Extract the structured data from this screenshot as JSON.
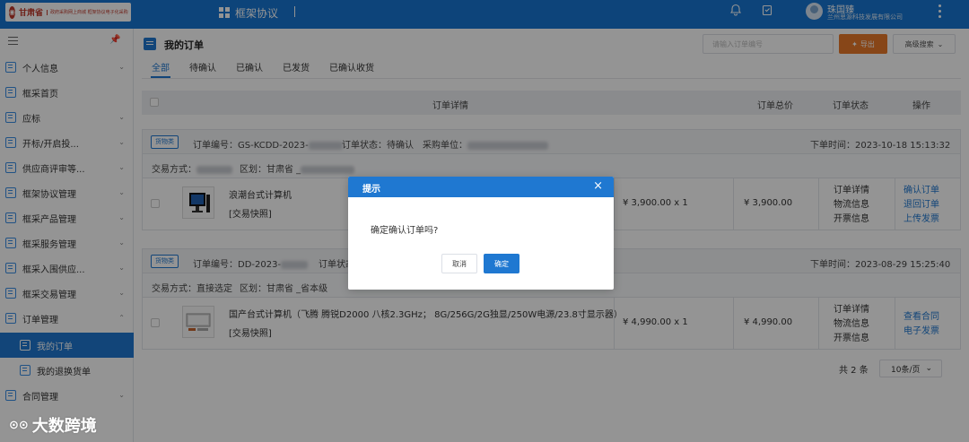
{
  "header": {
    "logo_name": "甘肃省",
    "logo_sub": "政府采购网上商城 框架协议电子化采购",
    "app_title": "框架协议",
    "user_name": "珠国臻",
    "user_org": "兰州思源科技发展有限公司",
    "icons": [
      "bell-icon",
      "clipboard-icon",
      "kebab-icon"
    ]
  },
  "sidebar": {
    "items": [
      {
        "label": "个人信息",
        "chevron": true
      },
      {
        "label": "框采首页",
        "chevron": false
      },
      {
        "label": "应标",
        "chevron": true
      },
      {
        "label": "开标/开启投...",
        "chevron": true
      },
      {
        "label": "供应商评审等...",
        "chevron": true
      },
      {
        "label": "框架协议管理",
        "chevron": true
      },
      {
        "label": "框采产品管理",
        "chevron": true
      },
      {
        "label": "框采服务管理",
        "chevron": true
      },
      {
        "label": "框采入围供应...",
        "chevron": true
      },
      {
        "label": "框采交易管理",
        "chevron": true
      },
      {
        "label": "订单管理",
        "chevron": true,
        "expanded": true
      },
      {
        "label": "我的订单",
        "sub": true,
        "active": true
      },
      {
        "label": "我的退换货单",
        "sub": true
      },
      {
        "label": "合同管理",
        "chevron": true
      }
    ]
  },
  "main": {
    "title": "我的订单",
    "search_placeholder": "请输入订单编号",
    "export_label": "导出",
    "adv_search_label": "高级搜索",
    "tabs": [
      "全部",
      "待确认",
      "已确认",
      "已发货",
      "已确认收货"
    ],
    "active_tab": 0,
    "columns": {
      "detail": "订单详情",
      "total": "订单总价",
      "status": "订单状态",
      "actions": "操作"
    },
    "orders": [
      {
        "badge": "货物类",
        "order_no": "订单编号：GS-KCDD-2023-",
        "status_label": "订单状态：待确认",
        "buyer_label": "采购单位：",
        "time": "下单时间：2023-10-18 15:13:32",
        "trade_mode": "交易方式：",
        "region": "区划：甘肃省 _",
        "product_name": "浪潮台式计算机",
        "product_tag": "[交易快照]",
        "price_qty": "¥ 3,900.00 x 1",
        "total": "¥ 3,900.00",
        "status_links": [
          "订单详情",
          "物流信息",
          "开票信息"
        ],
        "actions": [
          "确认订单",
          "退回订单",
          "上传发票"
        ]
      },
      {
        "badge": "货物类",
        "order_no": "订单编号：DD-2023-",
        "status_label": "订单状态",
        "buyer_label": "",
        "time": "下单时间：2023-08-29 15:25:40",
        "trade_mode": "交易方式：直接选定",
        "region": "区划：甘肃省 _省本级",
        "product_name": "国产台式计算机（飞腾 腾锐D2000 八核2.3GHz； 8G/256G/2G独显/250W电源/23.8寸显示器）",
        "product_tag": "[交易快照]",
        "price_qty": "¥ 4,990.00 x 1",
        "total": "¥ 4,990.00",
        "status_links": [
          "订单详情",
          "物流信息",
          "开票信息"
        ],
        "actions": [
          "查看合同",
          "电子发票"
        ]
      }
    ],
    "pager": {
      "total": "共 2 条",
      "page_size": "10条/页"
    }
  },
  "dialog": {
    "title": "提示",
    "message": "确定确认订单吗?",
    "cancel_label": "取消",
    "ok_label": "确定"
  },
  "watermark": "大数跨境",
  "colors": {
    "primary": "#1f78d1",
    "topbar": "#1776d2",
    "export": "#e8792a"
  }
}
